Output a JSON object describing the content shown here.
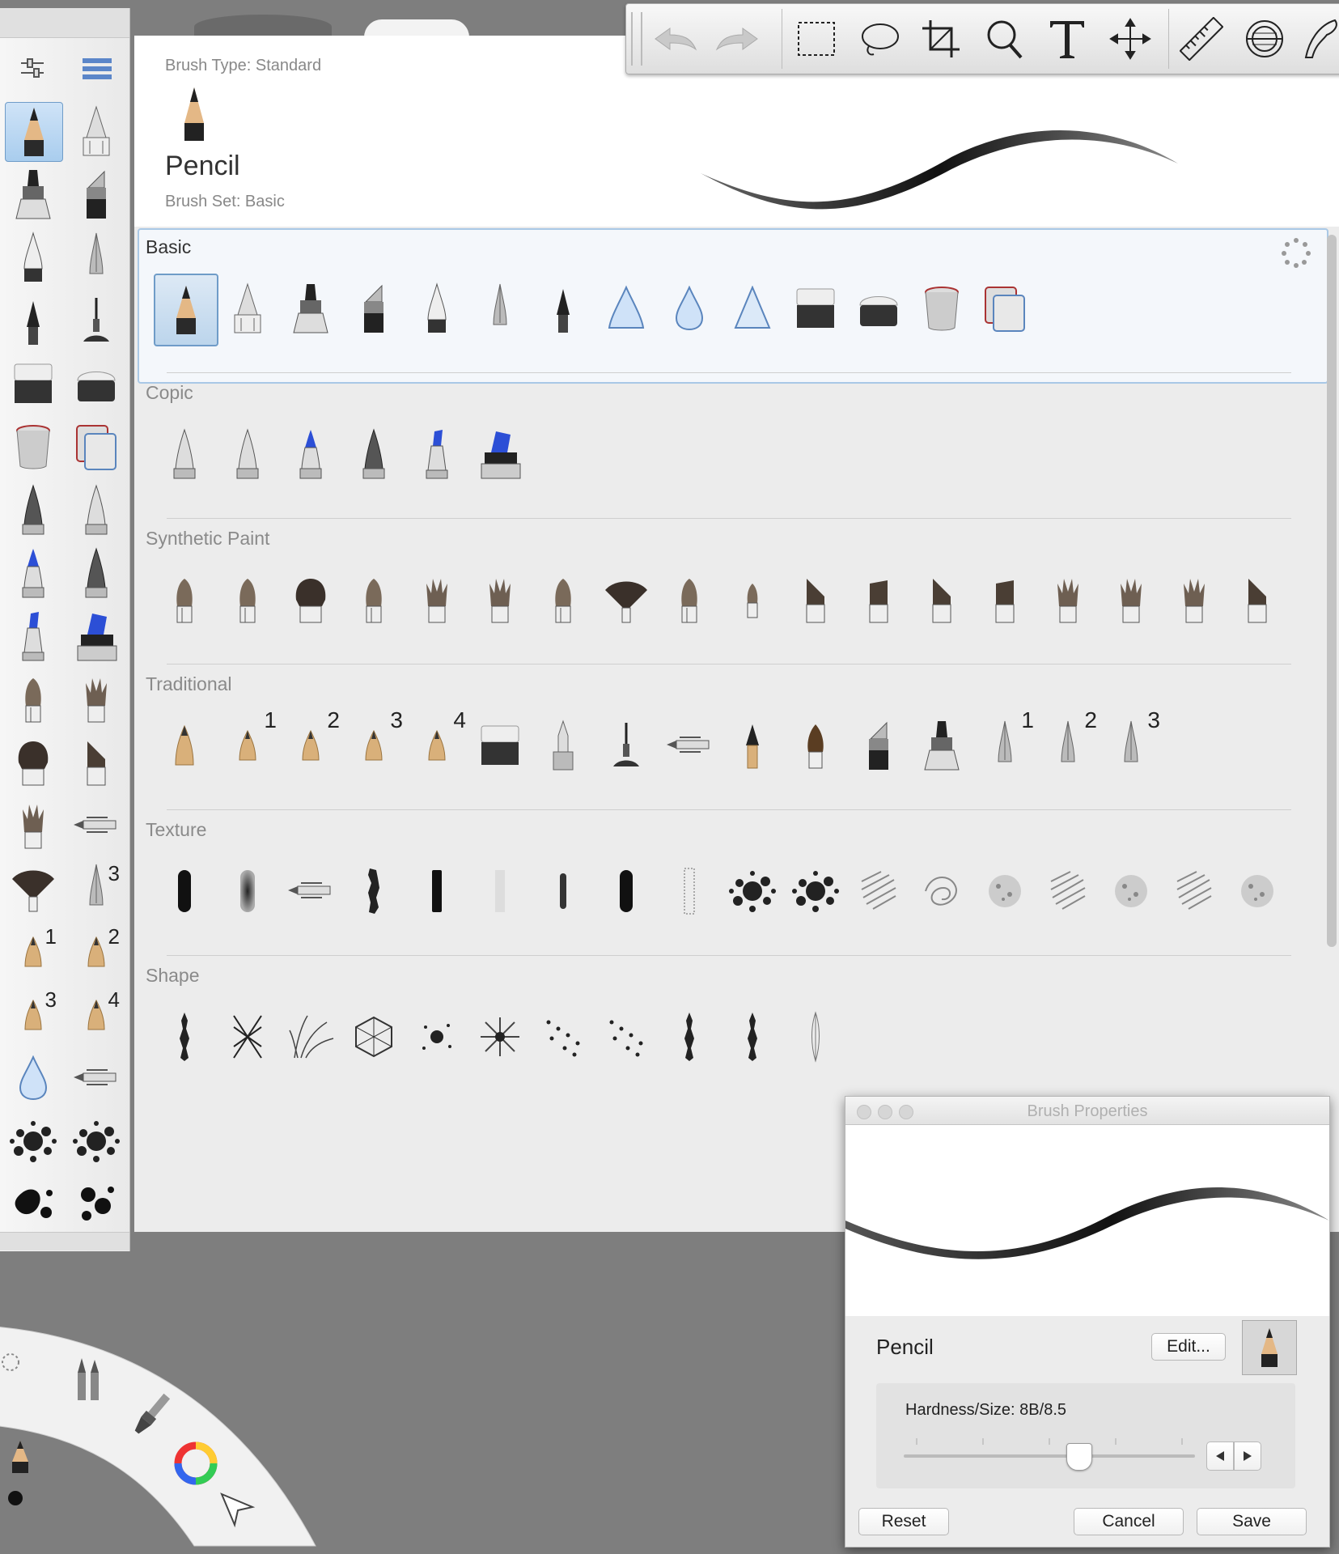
{
  "app": {
    "toolbar": {
      "tools": [
        "undo-icon",
        "redo-icon",
        "rect-select-icon",
        "lasso-icon",
        "crop-icon",
        "zoom-icon",
        "text-icon",
        "move-icon",
        "ruler-icon",
        "ellipse-guide-icon",
        "french-curve-icon"
      ]
    }
  },
  "header": {
    "brush_type": "Brush Type: Standard",
    "brush_name": "Pencil",
    "brush_set": "Brush Set: Basic"
  },
  "sections": [
    {
      "title": "Basic",
      "count": 14
    },
    {
      "title": "Copic",
      "count": 6
    },
    {
      "title": "Synthetic Paint",
      "count": 18
    },
    {
      "title": "Traditional",
      "count": 16
    },
    {
      "title": "Texture",
      "count": 18
    },
    {
      "title": "Shape",
      "count": 11
    }
  ],
  "traditional_numbers": [
    "",
    "1",
    "2",
    "3",
    "4",
    "",
    "",
    "",
    "",
    "",
    "",
    "",
    "",
    "1",
    "2",
    "3"
  ],
  "sidebar_numbers": {
    "r14b": "3",
    "r15a": "1",
    "r15b": "2",
    "r16a": "3",
    "r16b": "4"
  },
  "props": {
    "title": "Brush Properties",
    "name": "Pencil",
    "edit_label": "Edit...",
    "hardness_label": "Hardness/Size: 8B/8.5",
    "slider_value": 0.6,
    "reset_label": "Reset",
    "cancel_label": "Cancel",
    "save_label": "Save"
  },
  "colors": {
    "accent": "#6f9cc8",
    "copic_blue": "#2c4fd6",
    "panel": "#ececec"
  }
}
